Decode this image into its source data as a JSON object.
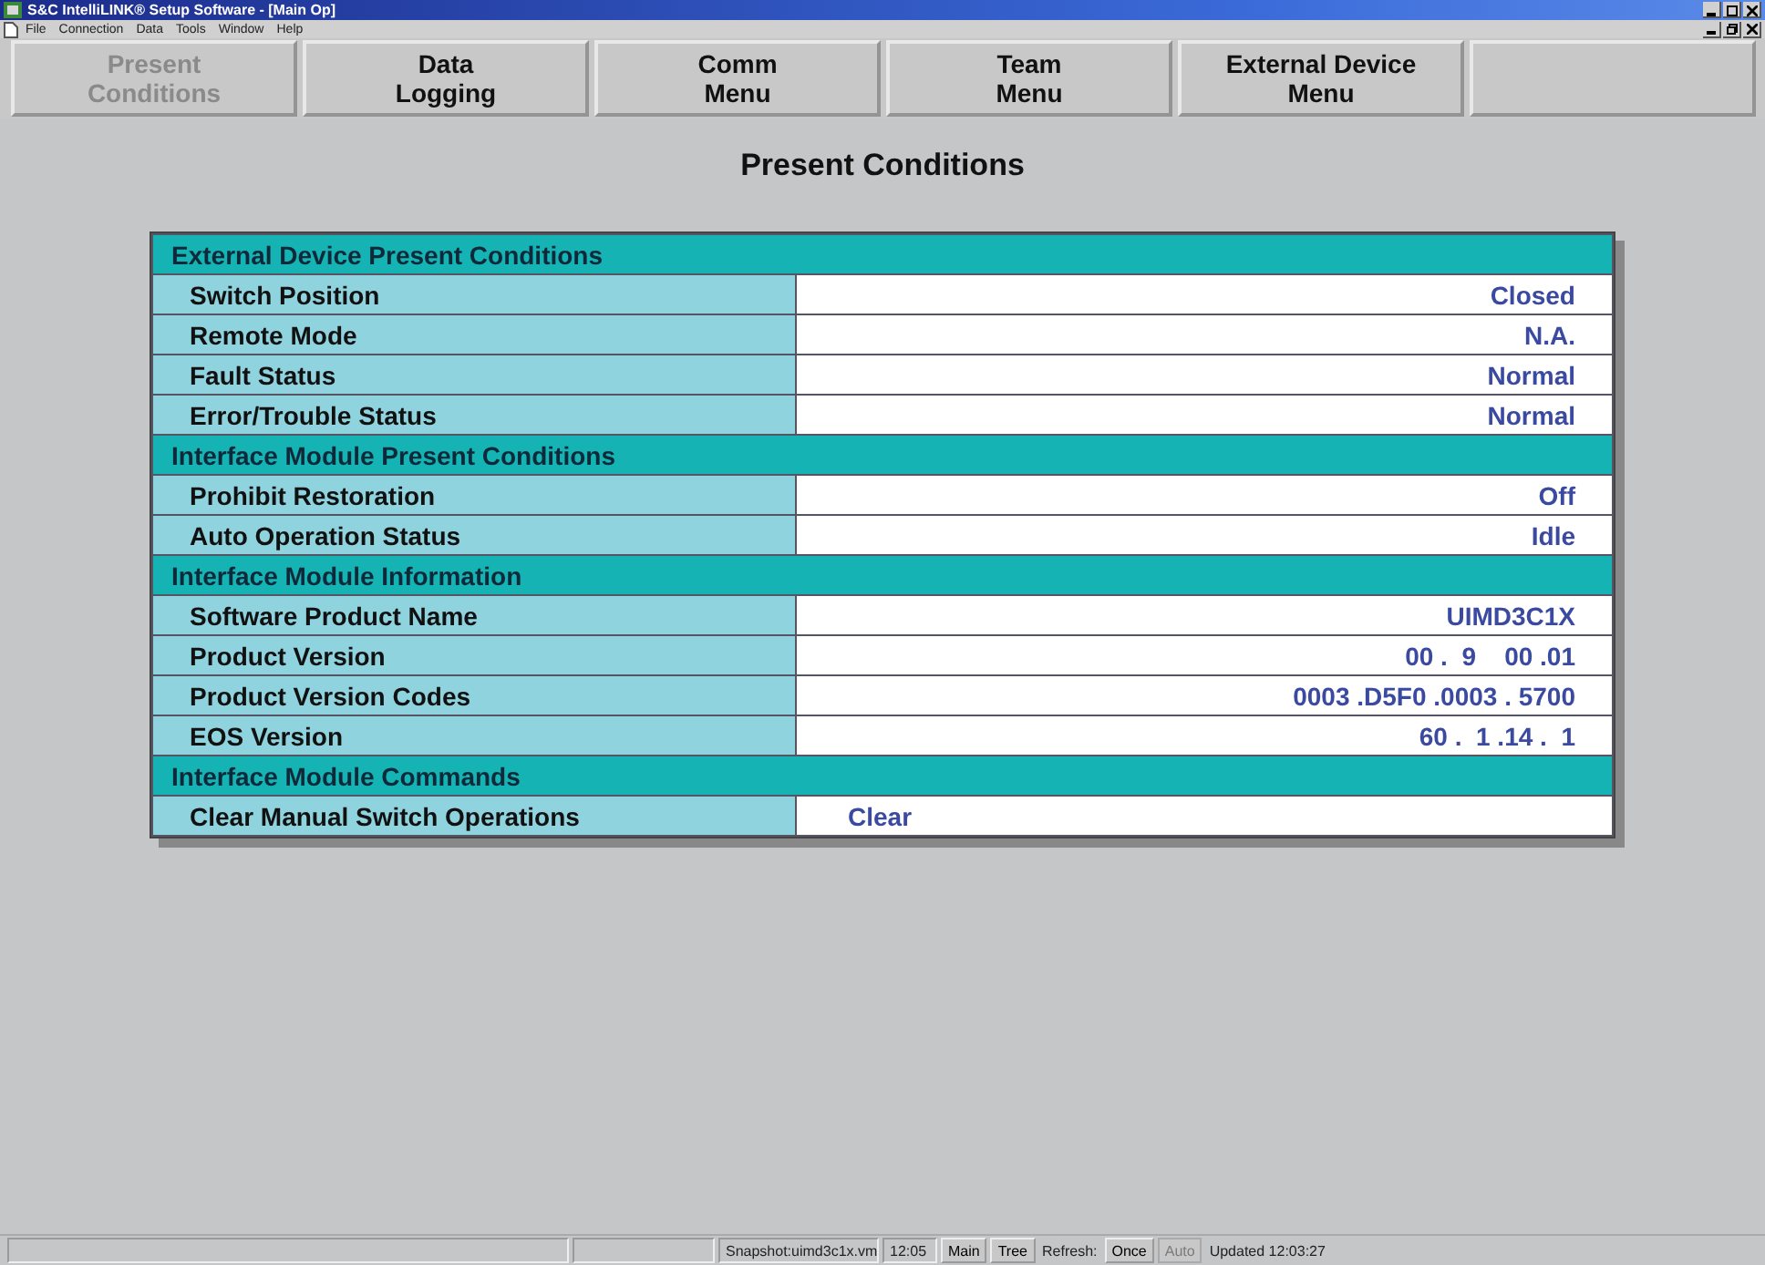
{
  "window": {
    "title": "S&C IntelliLINK® Setup Software - [Main Op]"
  },
  "menu": [
    "File",
    "Connection",
    "Data",
    "Tools",
    "Window",
    "Help"
  ],
  "nav_buttons": [
    {
      "kind": "command",
      "label": "Present\nConditions",
      "disabled": true
    },
    {
      "kind": "command",
      "label": "Data\nLogging",
      "disabled": false
    },
    {
      "kind": "command",
      "label": "Comm\nMenu",
      "disabled": false
    },
    {
      "kind": "command",
      "label": "Team\nMenu",
      "disabled": false
    },
    {
      "kind": "command",
      "label": "External Device\nMenu",
      "disabled": false
    },
    {
      "kind": "blank"
    }
  ],
  "heading": "Present Conditions",
  "sections": [
    {
      "title": "External Device Present Conditions",
      "rows": [
        {
          "label": "Switch Position",
          "value": "Closed",
          "kind": "value"
        },
        {
          "label": "Remote Mode",
          "value": "N.A.",
          "kind": "value"
        },
        {
          "label": "Fault Status",
          "value": "Normal",
          "kind": "value"
        },
        {
          "label": "Error/Trouble Status",
          "value": "Normal",
          "kind": "value"
        }
      ]
    },
    {
      "title": "Interface Module Present Conditions",
      "rows": [
        {
          "label": "Prohibit Restoration",
          "value": "Off",
          "kind": "value"
        },
        {
          "label": "Auto Operation Status",
          "value": "Idle",
          "kind": "value"
        }
      ]
    },
    {
      "title": "Interface Module Information",
      "rows": [
        {
          "label": "Software Product Name",
          "value": "UIMD3C1X",
          "kind": "value"
        },
        {
          "label": "Product Version",
          "value": "00 .  9    00 .01",
          "kind": "value"
        },
        {
          "label": "Product Version Codes",
          "value": "0003 .D5F0 .0003 . 5700",
          "kind": "value"
        },
        {
          "label": "EOS Version",
          "value": "60 .  1 .14 .  1",
          "kind": "value"
        }
      ]
    },
    {
      "title": "Interface Module Commands",
      "rows": [
        {
          "label": "Clear Manual Switch Operations",
          "value": "Clear",
          "kind": "action"
        }
      ]
    }
  ],
  "status_bar": [
    {
      "kind": "panel"
    },
    {
      "kind": "panel"
    },
    {
      "kind": "panel",
      "text": "Snapshot:uimd3c1x.vm"
    },
    {
      "kind": "panel",
      "text": "12:05"
    },
    {
      "kind": "button",
      "text": "Main",
      "disabled": false
    },
    {
      "kind": "button",
      "text": "Tree",
      "disabled": false
    },
    {
      "kind": "label",
      "text": "Refresh:"
    },
    {
      "kind": "button",
      "text": "Once",
      "disabled": false
    },
    {
      "kind": "button",
      "text": "Auto",
      "disabled": true
    },
    {
      "kind": "label",
      "text": "Updated 12:03:27"
    }
  ]
}
